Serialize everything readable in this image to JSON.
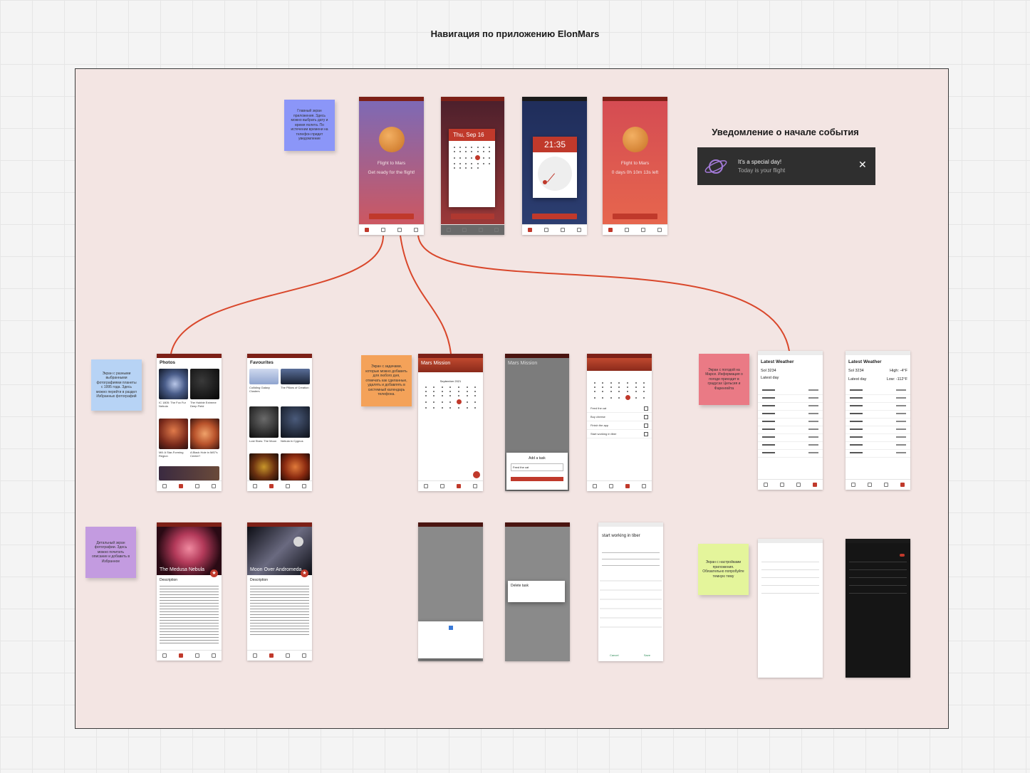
{
  "board": {
    "title": "Навигация по приложению ElonMars"
  },
  "notification": {
    "heading": "Уведомление о начале события",
    "title": "It's a special day!",
    "text": "Today is your flight"
  },
  "countdown": {
    "title": "Flight to Mars",
    "subtitle": "Get ready for the flight!",
    "timer": "0 days 0h 10m 13s left"
  },
  "date_picker": {
    "date": "Thu, Sep 16"
  },
  "time_picker": {
    "time": "21:35"
  },
  "photos": {
    "title": "Photos",
    "favourites_title": "Favourites",
    "items": [
      "IC 1805: The Fox Fur Nebula",
      "The Hubble Extreme Deep Field",
      "M8: A Star-Forming Region",
      "A Black Hole in M87's Center?"
    ],
    "fav_items": [
      "Colliding Galaxy Clusters",
      "The Pillars of Creation",
      "Lost Stars: The Moon",
      "Nebula in Cygnus"
    ]
  },
  "photo_details": [
    {
      "title": "The Medusa Nebula",
      "label": "Description"
    },
    {
      "title": "Moon Over Andromeda",
      "label": "Description"
    }
  ],
  "missions": {
    "title": "Mars Mission",
    "month": "September 2021",
    "add_title": "Add a task",
    "add_field": "Feed the cat",
    "tasks": [
      "Feed the cat",
      "Buy cheese",
      "Finish the app",
      "Start working in tiber"
    ],
    "delete_title": "Delete task"
  },
  "weather": {
    "title": "Latest Weather",
    "sol": "Sol 3234",
    "latest_day": "Latest day",
    "high": "High: -4°F",
    "low": "Low: -112°F"
  },
  "edit_task": {
    "title": "start working in tiber",
    "cancel": "Cancel",
    "save": "Save"
  },
  "stickies": {
    "main": "Главный экран приложения. Здесь можно выбрать дату и время полета. По истечении времени на телефон придет уведомление",
    "photos": "Экран с разными выбранными фотографиями планеты с 1995 года. Здесь можно перейти в раздел Избранных фотографий",
    "detail": "Детальный экран фотографии. Здесь можно почитать описание и добавить в Избранное",
    "missions": "Экран с задачами, которые можно добавить для любого дня, отмечать как сделанные, удалять и добавлять в системный календарь телефона.",
    "weather": "Экран с погодой на Марсе. Информация о погоде приходит в градусах Цельсия и Фаренгейта",
    "settings": "Экран с настройками приложения. Обязательно попробуйте темную тему"
  },
  "colors": {
    "frame_bg": "#f3e5e3",
    "connector": "#d9472b",
    "accent": "#c0392b",
    "sticky_blue": "#8b96f8",
    "sticky_lightblue": "#b7d3f5",
    "sticky_orange": "#f4a259",
    "sticky_purple": "#c39be0",
    "sticky_pink": "#ea7a85",
    "sticky_green": "#e4f59b"
  }
}
